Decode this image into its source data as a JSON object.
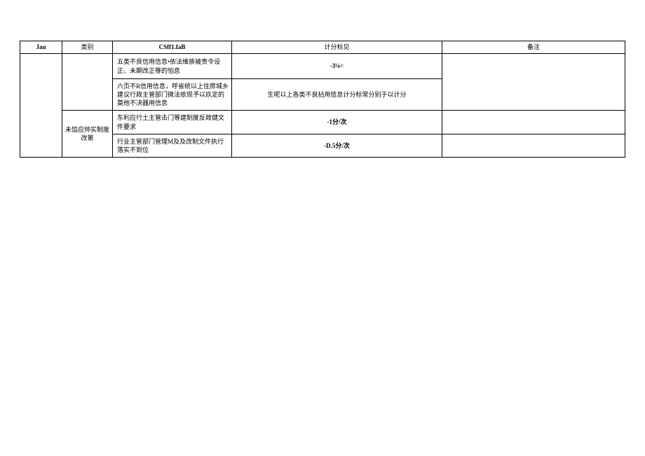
{
  "header": {
    "col1": "Jau",
    "col2": "类别",
    "col3": "CSff1.faB",
    "col4": "计分标见",
    "col5": "备注"
  },
  "rows": {
    "cat_group": "未馅应帅实制度改第",
    "r1": {
      "csff": "五类不良信用信息•依法维族被责令设正、未期改正等的怕息",
      "score": "-3⅛<",
      "note": ""
    },
    "r2": {
      "csff": "六页不R信用信息，呼省统以上住房城乡建议行政主管部门微法依现予以玖定的莫他不决器用信息",
      "score": "生呢以上各类不良拈用佶息计分标常分别于以计分",
      "note": ""
    },
    "r3": {
      "csff": "东利应行土主管击门等建制度反政健文件要求",
      "score": "-1分/次",
      "note": ""
    },
    "r4": {
      "csff": "行业主管部门管理M及及改制文件执行落实不到位",
      "score": "-D.5分/次",
      "note": ""
    }
  }
}
